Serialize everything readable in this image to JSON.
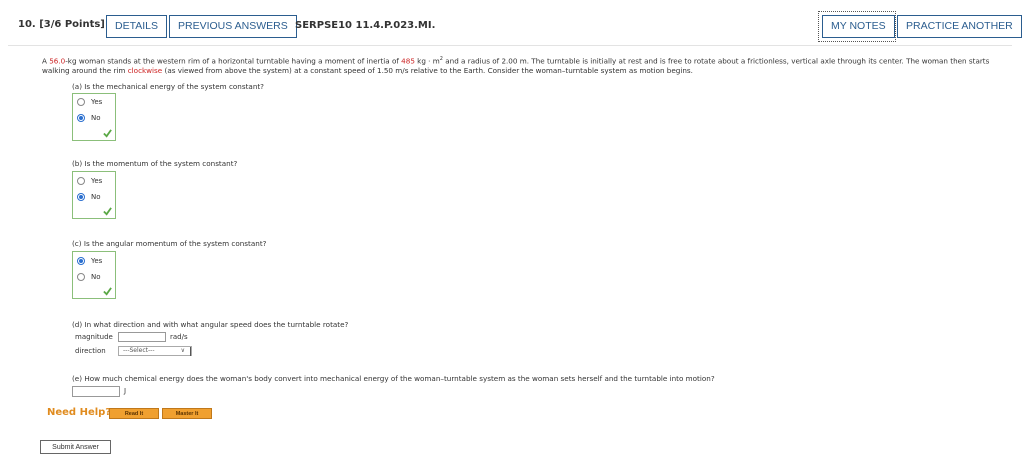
{
  "header": {
    "question_label": "10.  [3/6 Points]",
    "details": "DETAILS",
    "previous_answers": "PREVIOUS ANSWERS",
    "code": "SERPSE10 11.4.P.023.MI.",
    "my_notes": "MY NOTES",
    "practice_another": "PRACTICE ANOTHER"
  },
  "statement": {
    "t1": "A ",
    "mass": "56.0",
    "t2": "-kg woman stands at the western rim of a horizontal turntable having a moment of inertia of ",
    "inertia": "485",
    "t3": " kg · m",
    "sup": "2",
    "t4": " and a radius of 2.00 m. The turntable is initially at rest and is free to rotate about a frictionless, vertical axle through its center. The woman then starts walking around the rim ",
    "direction": "clockwise",
    "t5": " (as viewed from above the system) at a constant speed of 1.50 m/s relative to the Earth. Consider the woman–turntable system as motion begins."
  },
  "parts": {
    "a": {
      "question": "(a) Is the mechanical energy of the system constant?",
      "yes": "Yes",
      "no": "No"
    },
    "b": {
      "question": "(b) Is the momentum of the system constant?",
      "yes": "Yes",
      "no": "No"
    },
    "c": {
      "question": "(c) Is the angular momentum of the system constant?",
      "yes": "Yes",
      "no": "No"
    },
    "d": {
      "question": "(d) In what direction and with what angular speed does the turntable rotate?",
      "magnitude_label": "magnitude",
      "magnitude_value": "",
      "unit": "rad/s",
      "direction_label": "direction",
      "direction_selected": "---Select---"
    },
    "e": {
      "question": "(e) How much chemical energy does the woman's body convert into mechanical energy of the woman–turntable system as the woman sets herself and the turntable into motion?",
      "value": "",
      "unit": "J"
    }
  },
  "help": {
    "label": "Need Help?",
    "read_it": "Read It",
    "master_it": "Master It"
  },
  "submit": "Submit Answer",
  "colors": {
    "accent": "#2b5d8f",
    "correct": "#5aa845",
    "help": "#e08b1e",
    "highlight": "#cc2222"
  }
}
